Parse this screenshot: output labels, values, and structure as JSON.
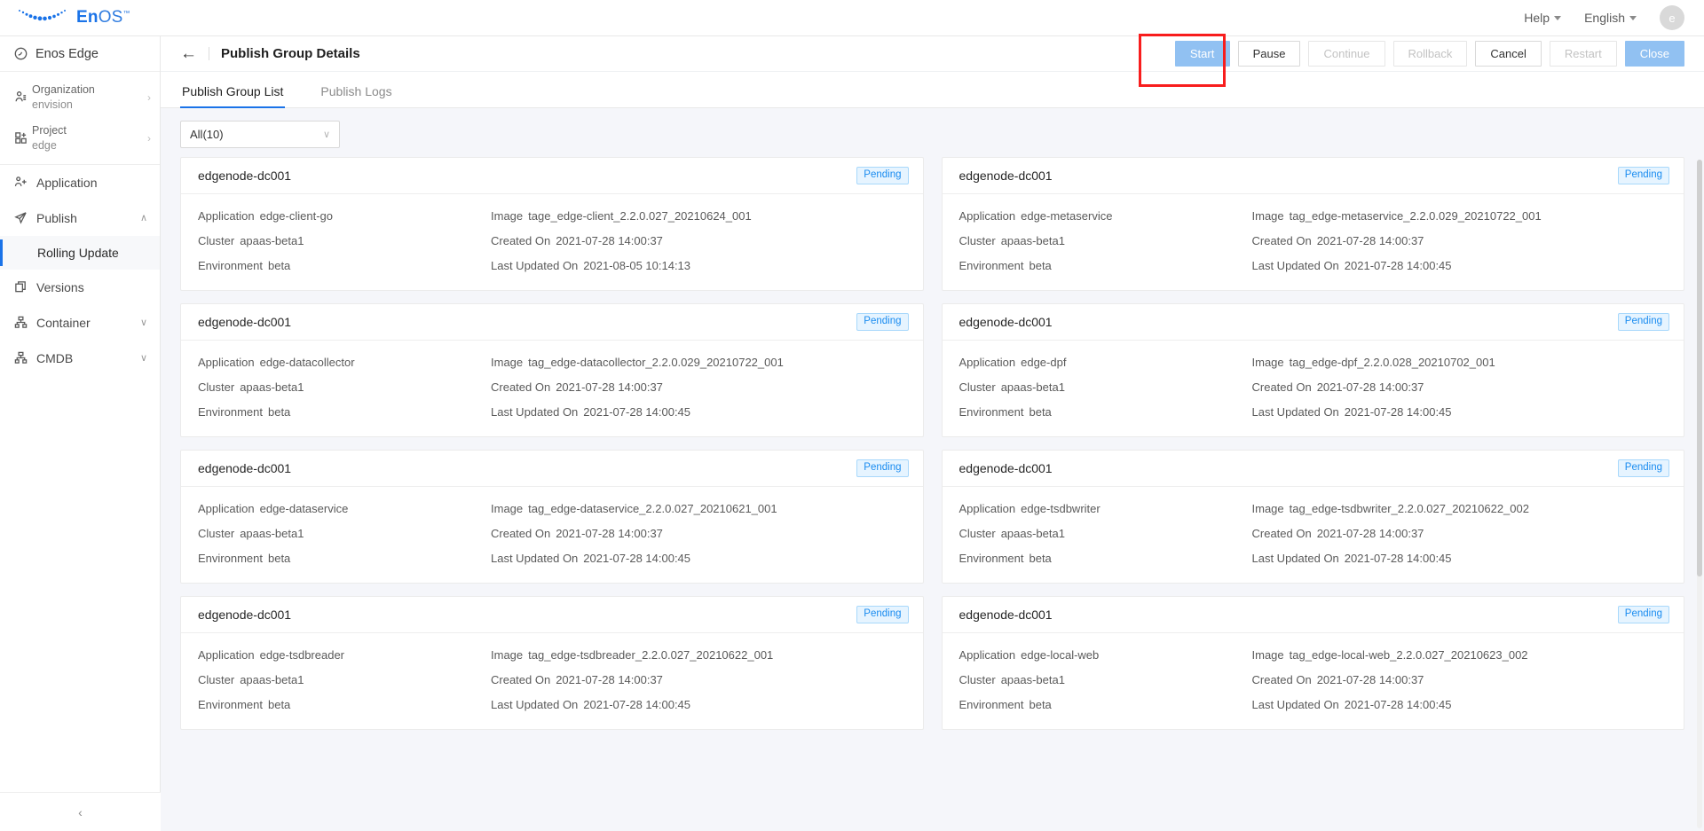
{
  "brand": {
    "name_bold": "En",
    "name_light": "OS",
    "tm": "™"
  },
  "topbar": {
    "help_label": "Help",
    "language_label": "English",
    "avatar_initial": "e"
  },
  "sidebar": {
    "product": "Enos Edge",
    "selectors": [
      {
        "label": "Organization",
        "value": "envision",
        "icon": "organization-icon",
        "arrow": "›"
      },
      {
        "label": "Project",
        "value": "edge",
        "icon": "project-icon",
        "arrow": "›"
      }
    ],
    "items": [
      {
        "label": "Application",
        "icon": "application-icon",
        "chevron": ""
      },
      {
        "label": "Publish",
        "icon": "publish-icon",
        "chevron": "∧"
      },
      {
        "label": "Versions",
        "icon": "versions-icon",
        "chevron": ""
      },
      {
        "label": "Container",
        "icon": "container-icon",
        "chevron": "∨"
      },
      {
        "label": "CMDB",
        "icon": "cmdb-icon",
        "chevron": "∨"
      }
    ],
    "submenu": {
      "label": "Rolling Update"
    },
    "collapse_icon": "‹"
  },
  "header": {
    "back_icon": "←",
    "title": "Publish Group Details",
    "buttons": [
      {
        "label": "Start",
        "state": "primary",
        "name": "start-button"
      },
      {
        "label": "Pause",
        "state": "default",
        "name": "pause-button"
      },
      {
        "label": "Continue",
        "state": "disabled",
        "name": "continue-button"
      },
      {
        "label": "Rollback",
        "state": "disabled",
        "name": "rollback-button"
      },
      {
        "label": "Cancel",
        "state": "default",
        "name": "cancel-button"
      },
      {
        "label": "Restart",
        "state": "disabled",
        "name": "restart-button"
      },
      {
        "label": "Close",
        "state": "primary",
        "name": "close-button"
      }
    ],
    "highlight_color": "#f81d1d"
  },
  "tabs": [
    {
      "label": "Publish Group List",
      "active": true
    },
    {
      "label": "Publish Logs",
      "active": false
    }
  ],
  "filter": {
    "value": "All(10)",
    "chevron": "∨"
  },
  "labels": {
    "application": "Application",
    "cluster": "Cluster",
    "environment": "Environment",
    "image": "Image",
    "created_on": "Created On",
    "last_updated_on": "Last Updated On"
  },
  "cards": [
    {
      "title": "edgenode-dc001",
      "status": "Pending",
      "application": "edge-client-go",
      "cluster": "apaas-beta1",
      "environment": "beta",
      "image": "tage_edge-client_2.2.0.027_20210624_001",
      "created_on": "2021-07-28 14:00:37",
      "last_updated_on": "2021-08-05 10:14:13"
    },
    {
      "title": "edgenode-dc001",
      "status": "Pending",
      "application": "edge-metaservice",
      "cluster": "apaas-beta1",
      "environment": "beta",
      "image": "tag_edge-metaservice_2.2.0.029_20210722_001",
      "created_on": "2021-07-28 14:00:37",
      "last_updated_on": "2021-07-28 14:00:45"
    },
    {
      "title": "edgenode-dc001",
      "status": "Pending",
      "application": "edge-datacollector",
      "cluster": "apaas-beta1",
      "environment": "beta",
      "image": "tag_edge-datacollector_2.2.0.029_20210722_001",
      "created_on": "2021-07-28 14:00:37",
      "last_updated_on": "2021-07-28 14:00:45"
    },
    {
      "title": "edgenode-dc001",
      "status": "Pending",
      "application": "edge-dpf",
      "cluster": "apaas-beta1",
      "environment": "beta",
      "image": "tag_edge-dpf_2.2.0.028_20210702_001",
      "created_on": "2021-07-28 14:00:37",
      "last_updated_on": "2021-07-28 14:00:45"
    },
    {
      "title": "edgenode-dc001",
      "status": "Pending",
      "application": "edge-dataservice",
      "cluster": "apaas-beta1",
      "environment": "beta",
      "image": "tag_edge-dataservice_2.2.0.027_20210621_001",
      "created_on": "2021-07-28 14:00:37",
      "last_updated_on": "2021-07-28 14:00:45"
    },
    {
      "title": "edgenode-dc001",
      "status": "Pending",
      "application": "edge-tsdbwriter",
      "cluster": "apaas-beta1",
      "environment": "beta",
      "image": "tag_edge-tsdbwriter_2.2.0.027_20210622_002",
      "created_on": "2021-07-28 14:00:37",
      "last_updated_on": "2021-07-28 14:00:45"
    },
    {
      "title": "edgenode-dc001",
      "status": "Pending",
      "application": "edge-tsdbreader",
      "cluster": "apaas-beta1",
      "environment": "beta",
      "image": "tag_edge-tsdbreader_2.2.0.027_20210622_001",
      "created_on": "2021-07-28 14:00:37",
      "last_updated_on": "2021-07-28 14:00:45"
    },
    {
      "title": "edgenode-dc001",
      "status": "Pending",
      "application": "edge-local-web",
      "cluster": "apaas-beta1",
      "environment": "beta",
      "image": "tag_edge-local-web_2.2.0.027_20210623_002",
      "created_on": "2021-07-28 14:00:37",
      "last_updated_on": "2021-07-28 14:00:45"
    }
  ],
  "colors": {
    "accent": "#1a73e8",
    "primary_button": "#91c1f2",
    "badge_text": "#1a8cf0"
  }
}
